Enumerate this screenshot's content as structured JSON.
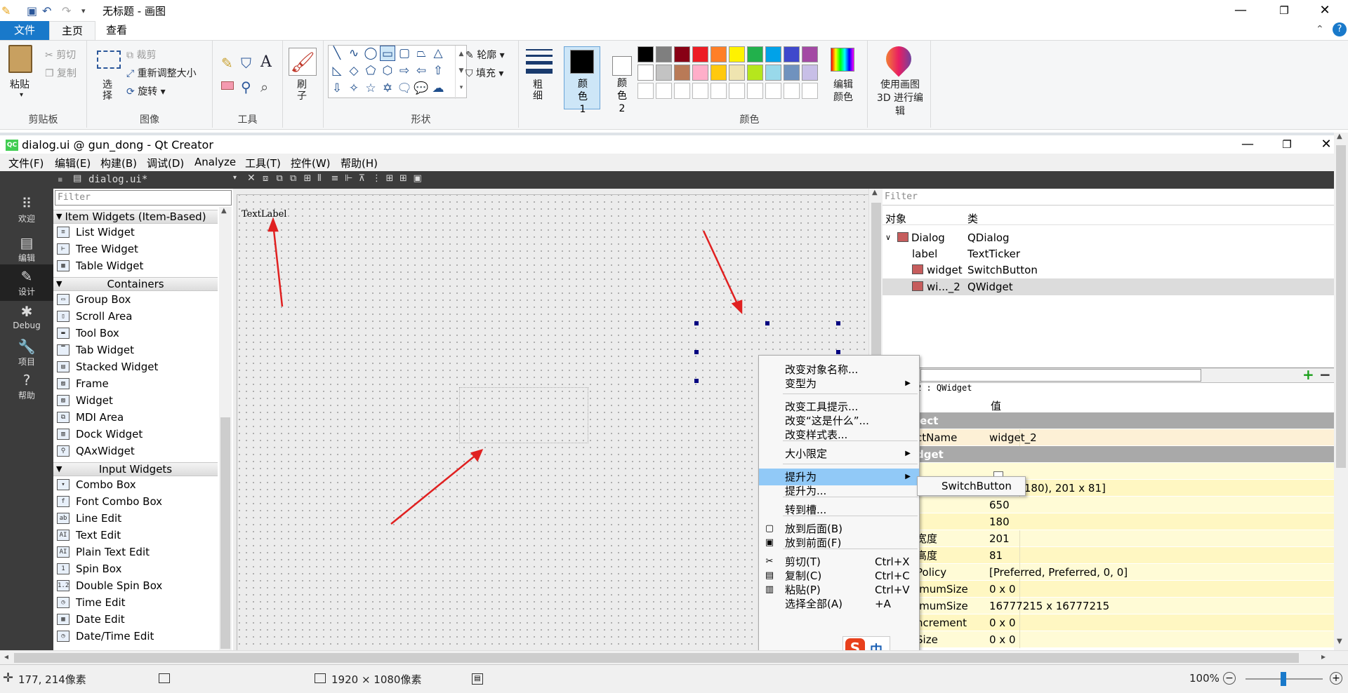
{
  "paint": {
    "window_title": "无标题 - 画图",
    "tabs": [
      "文件",
      "主页",
      "查看"
    ],
    "ribbon": {
      "clipboard": {
        "paste": "粘贴",
        "cut": "剪切",
        "copy": "复制",
        "group": "剪贴板"
      },
      "image": {
        "select": "选择",
        "crop": "裁剪",
        "resize": "重新调整大小",
        "rotate": "旋转",
        "group": "图像"
      },
      "tools": {
        "group": "工具"
      },
      "brushes": {
        "label": "刷子"
      },
      "shapes": {
        "outline": "轮廓",
        "fill": "填充",
        "group": "形状"
      },
      "size": {
        "label": "粗细"
      },
      "color1": {
        "label": "颜色 1"
      },
      "color2": {
        "label": "颜色 2"
      },
      "colors": {
        "group": "颜色",
        "palette_row1": [
          "#000000",
          "#7f7f7f",
          "#880015",
          "#ed1c24",
          "#ff7f27",
          "#fff200",
          "#22b14c",
          "#00a2e8",
          "#3f48cc",
          "#a349a4"
        ],
        "palette_row2": [
          "#ffffff",
          "#c3c3c3",
          "#b97a57",
          "#ffaec9",
          "#ffc90e",
          "#efe4b0",
          "#b5e61d",
          "#99d9ea",
          "#7092be",
          "#c8bfe7"
        ],
        "edit": "编辑颜色"
      },
      "paint3d": "使用画图 3D 进行编辑"
    },
    "status": {
      "cursor": "177, 214像素",
      "canvas_size": "1920 × 1080像素",
      "zoom": "100%"
    }
  },
  "qt": {
    "window_title": "dialog.ui @ gun_dong - Qt Creator",
    "menu": [
      "文件(F)",
      "编辑(E)",
      "构建(B)",
      "调试(D)",
      "Analyze",
      "工具(T)",
      "控件(W)",
      "帮助(H)"
    ],
    "open_file": "dialog.ui*",
    "modes": [
      {
        "label": "欢迎",
        "icon": "grid-icon"
      },
      {
        "label": "编辑",
        "icon": "document-icon"
      },
      {
        "label": "设计",
        "icon": "pencil-icon"
      },
      {
        "label": "Debug",
        "icon": "bug-icon"
      },
      {
        "label": "项目",
        "icon": "wrench-icon"
      },
      {
        "label": "帮助",
        "icon": "help-icon"
      }
    ],
    "widget_box": {
      "filter_placeholder": "Filter",
      "categories": [
        "Item Widgets (Item-Based)",
        "Containers",
        "Input Widgets"
      ],
      "item_widgets": [
        "List Widget",
        "Tree Widget",
        "Table Widget"
      ],
      "containers": [
        "Group Box",
        "Scroll Area",
        "Tool Box",
        "Tab Widget",
        "Stacked Widget",
        "Frame",
        "Widget",
        "MDI Area",
        "Dock Widget",
        "QAxWidget"
      ],
      "input_widgets": [
        "Combo Box",
        "Font Combo Box",
        "Line Edit",
        "Text Edit",
        "Plain Text Edit",
        "Spin Box",
        "Double Spin Box",
        "Time Edit",
        "Date Edit",
        "Date/Time Edit"
      ]
    },
    "canvas": {
      "text_label": "TextLabel"
    },
    "object_inspector": {
      "filter_placeholder": "Filter",
      "col_object": "对象",
      "col_class": "类",
      "rows": [
        {
          "object": "Dialog",
          "class": "QDialog"
        },
        {
          "object": "label",
          "class": "TextTicker"
        },
        {
          "object": "widget",
          "class": "SwitchButton"
        },
        {
          "object": "wi..._2",
          "class": "QWidget"
        }
      ]
    },
    "property_editor": {
      "class_line": "2 : QWidget",
      "col_value": "值",
      "rows": [
        {
          "key": "ject",
          "value": "",
          "type": "group"
        },
        {
          "key": "ctName",
          "value": "widget_2",
          "type": "obj"
        },
        {
          "key": "dget",
          "value": "",
          "type": "group"
        },
        {
          "key": "",
          "value": "",
          "type": "y1"
        },
        {
          "key": "etry",
          "value": "[(650, 180), 201 x 81]",
          "type": "y2"
        },
        {
          "key": "",
          "value": "650",
          "type": "y1"
        },
        {
          "key": "",
          "value": "180",
          "type": "y2"
        },
        {
          "key": "宽度",
          "value": "201",
          "type": "y1"
        },
        {
          "key": "高度",
          "value": "81",
          "type": "y2"
        },
        {
          "key": "Policy",
          "value": "[Preferred, Preferred, 0, 0]",
          "type": "y1"
        },
        {
          "key": "imumSize",
          "value": "0 x 0",
          "type": "y2"
        },
        {
          "key": "imumSize",
          "value": "16777215 x 16777215",
          "type": "y1"
        },
        {
          "key": "ncrement",
          "value": "0 x 0",
          "type": "y2"
        },
        {
          "key": "Size",
          "value": "0 x 0",
          "type": "y1"
        }
      ]
    },
    "context_menu": {
      "items": [
        {
          "label": "改变对象名称...",
          "shortcut": ""
        },
        {
          "label": "变型为",
          "shortcut": "",
          "submenu": true
        },
        {
          "label": "改变工具提示...",
          "shortcut": ""
        },
        {
          "label": "改变“这是什么”...",
          "shortcut": ""
        },
        {
          "label": "改变样式表...",
          "shortcut": ""
        },
        {
          "label": "大小限定",
          "shortcut": "",
          "submenu": true
        },
        {
          "label": "提升为",
          "shortcut": "",
          "submenu": true
        },
        {
          "label": "提升为...",
          "shortcut": ""
        },
        {
          "label": "转到槽...",
          "shortcut": ""
        },
        {
          "label": "放到后面(B)",
          "shortcut": ""
        },
        {
          "label": "放到前面(F)",
          "shortcut": ""
        },
        {
          "label": "剪切(T)",
          "shortcut": "Ctrl+X"
        },
        {
          "label": "复制(C)",
          "shortcut": "Ctrl+C"
        },
        {
          "label": "粘贴(P)",
          "shortcut": "Ctrl+V"
        },
        {
          "label": "选择全部(A)",
          "shortcut": "+A"
        }
      ],
      "submenu_item": "SwitchButton"
    },
    "ime": "中"
  }
}
